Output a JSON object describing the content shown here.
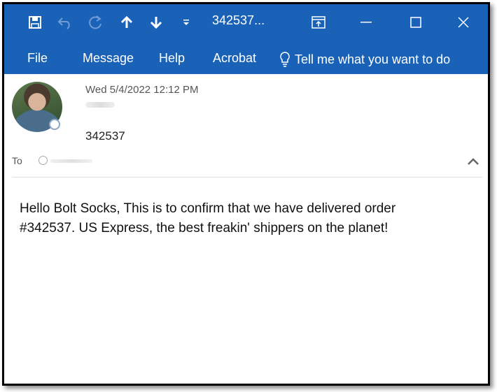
{
  "window": {
    "title": "342537...",
    "titlebar_icons": [
      "save-icon",
      "undo-icon",
      "redo-icon",
      "up-arrow-icon",
      "down-arrow-icon",
      "customize-dropdown-icon",
      "restore-ribbon-icon",
      "minimize-icon",
      "maximize-icon",
      "close-icon"
    ]
  },
  "menu": {
    "items": [
      "File",
      "Message",
      "Help",
      "Acrobat"
    ],
    "tell_me": "Tell me what you want to do"
  },
  "message": {
    "date": "Wed 5/4/2022 12:12 PM",
    "subject": "342537",
    "to_label": "To",
    "body_lines": [
      "Hello Bolt Socks, This is to confirm that we have delivered order",
      "#342537. US Express, the best freakin' shippers on the planet!"
    ]
  },
  "colors": {
    "accent": "#1a62b8",
    "text": "#111111",
    "muted": "#555555"
  }
}
